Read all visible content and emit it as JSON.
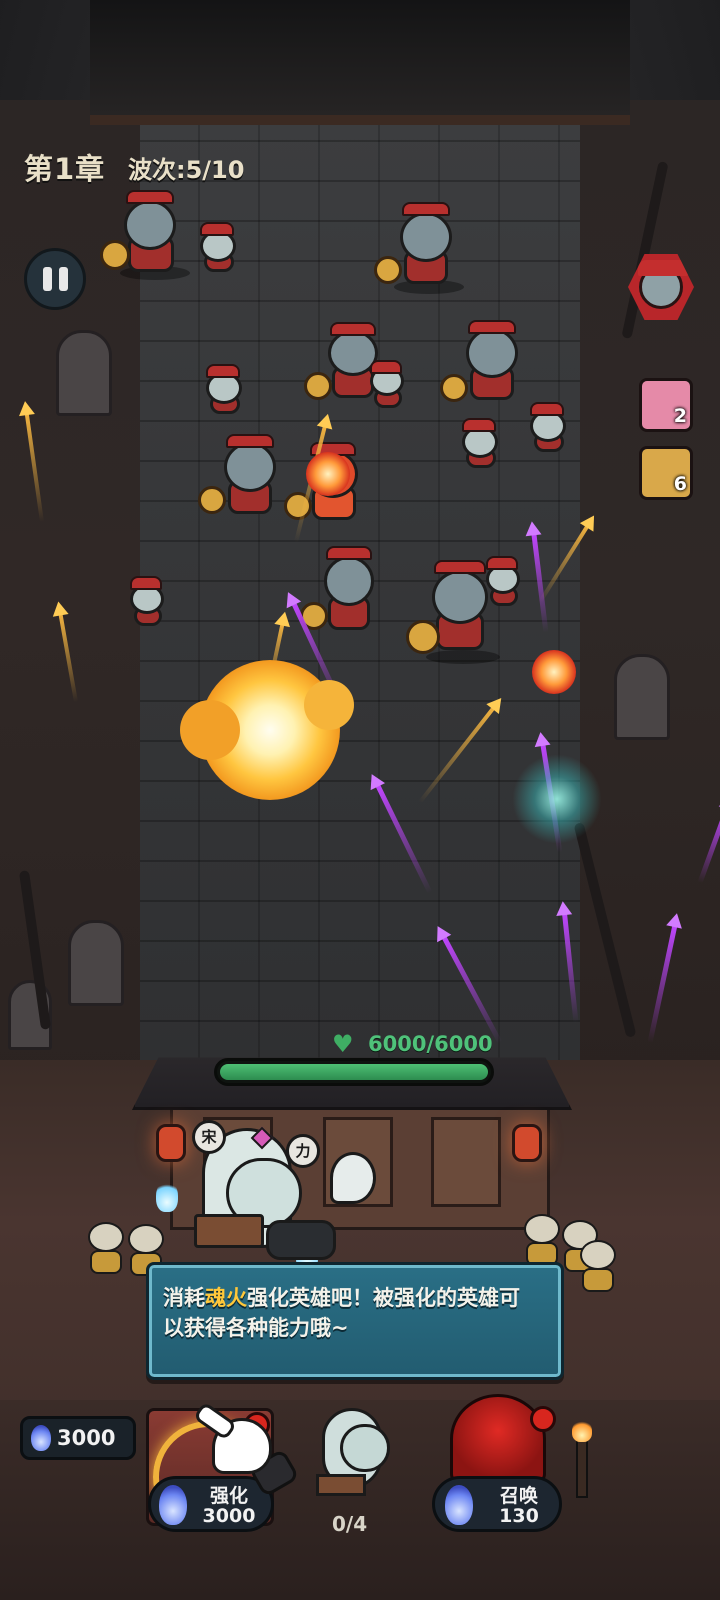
{
  "hud": {
    "chapter": "第1章",
    "wave": "波次:5/10"
  },
  "enemy_queue": {
    "boss_icon": "general-face-icon",
    "cards": [
      {
        "count": "2",
        "color": "#e58aa8"
      },
      {
        "count": "6",
        "color": "#d9a84a"
      }
    ]
  },
  "base": {
    "hp": "6000/6000",
    "hp_fraction": 1.0,
    "heart_icon": "heart-icon"
  },
  "tutorial": {
    "prefix": "消耗",
    "highlight": "魂火",
    "suffix": "强化英雄吧！被强化的英雄可以获得各种能力哦~",
    "highlight_color": "#ffc83a",
    "char_1": "宋",
    "char_2": "力"
  },
  "bottom_bar": {
    "soul_fire_total": "3000",
    "upgrade": {
      "label": "强化",
      "cost": "3000"
    },
    "hero_slots": "0/4",
    "summon": {
      "label": "召唤",
      "cost": "130"
    }
  },
  "colors": {
    "accent_gold": "#f0b33c",
    "hp_green": "#4fc27a",
    "dialog_blue": "#2a6f86",
    "purple_arrow": "#c046ff"
  }
}
